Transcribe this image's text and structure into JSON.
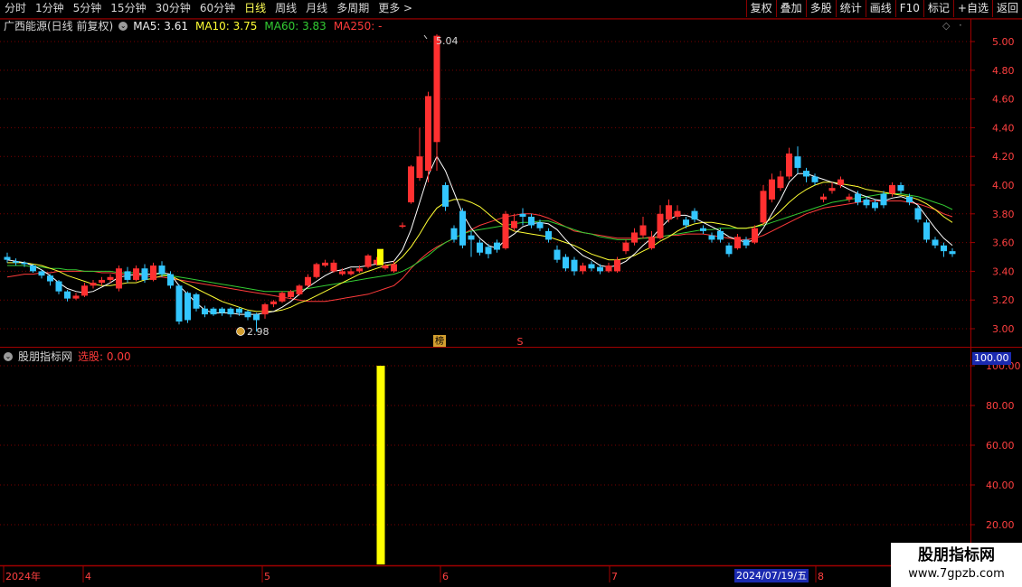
{
  "toolbar": {
    "periods": [
      "分时",
      "1分钟",
      "5分钟",
      "15分钟",
      "30分钟",
      "60分钟",
      "日线",
      "周线",
      "月线",
      "多周期",
      "更多 >"
    ],
    "active_period": "日线",
    "tools": [
      "复权",
      "叠加",
      "多股",
      "统计",
      "画线",
      "F10",
      "标记",
      "+自选",
      "返回"
    ]
  },
  "main_header": {
    "stock": "广西能源(日线 前复权)",
    "ma5": "MA5: 3.61",
    "ma10": "MA10: 3.75",
    "ma60": "MA60: 3.83",
    "ma250": "MA250: -"
  },
  "sub_header": {
    "indicator": "股朋指标网",
    "xuangu": "选股: 0.00"
  },
  "colors": {
    "up": "#ff3030",
    "down": "#33c6ff",
    "ma5": "#ffffff",
    "ma10": "#ffff33",
    "ma60": "#33cc33",
    "ma250": "#ff3b3b",
    "frame": "#a00000",
    "signal": "#ffff00"
  },
  "annotations": {
    "high_label": "5.04",
    "low_label": "2.98",
    "bang_icon_text": "榜",
    "s_icon_text": "S"
  },
  "axis": {
    "price_ticks": [
      "5.00",
      "4.80",
      "4.60",
      "4.40",
      "4.20",
      "4.00",
      "3.80",
      "3.60",
      "3.40",
      "3.20",
      "3.00"
    ],
    "indicator_ticks": [
      "100.00",
      "80.00",
      "60.00",
      "40.00",
      "20.00"
    ],
    "indicator_current": "100.00",
    "date_labels": [
      "2024年",
      "4",
      "5",
      "6",
      "7",
      "8"
    ],
    "crosshair_date": "2024/07/19/五"
  },
  "watermark": {
    "title": "股朋指标网",
    "url": "www.7gpzb.com"
  },
  "chart_data": {
    "type": "candlestick",
    "ylim": [
      2.9,
      5.1
    ],
    "indicator_ylim": [
      0,
      100
    ],
    "signal_index": 43,
    "signal_value": 100,
    "candles": [
      [
        3.5,
        3.48,
        3.53,
        3.46
      ],
      [
        3.47,
        3.46,
        3.49,
        3.44
      ],
      [
        3.46,
        3.45,
        3.47,
        3.43
      ],
      [
        3.44,
        3.4,
        3.45,
        3.39
      ],
      [
        3.4,
        3.37,
        3.41,
        3.35
      ],
      [
        3.37,
        3.33,
        3.38,
        3.3
      ],
      [
        3.33,
        3.26,
        3.34,
        3.24
      ],
      [
        3.26,
        3.21,
        3.27,
        3.19
      ],
      [
        3.21,
        3.23,
        3.25,
        3.2
      ],
      [
        3.23,
        3.3,
        3.32,
        3.22
      ],
      [
        3.3,
        3.32,
        3.34,
        3.28
      ],
      [
        3.32,
        3.34,
        3.36,
        3.3
      ],
      [
        3.34,
        3.36,
        3.38,
        3.32
      ],
      [
        3.28,
        3.42,
        3.44,
        3.26
      ],
      [
        3.4,
        3.34,
        3.43,
        3.32
      ],
      [
        3.34,
        3.42,
        3.44,
        3.33
      ],
      [
        3.42,
        3.34,
        3.45,
        3.32
      ],
      [
        3.34,
        3.44,
        3.46,
        3.33
      ],
      [
        3.44,
        3.38,
        3.47,
        3.36
      ],
      [
        3.38,
        3.3,
        3.4,
        3.28
      ],
      [
        3.3,
        3.05,
        3.31,
        3.03
      ],
      [
        3.25,
        3.06,
        3.26,
        3.04
      ],
      [
        3.24,
        3.14,
        3.25,
        3.12
      ],
      [
        3.14,
        3.1,
        3.16,
        3.08
      ],
      [
        3.14,
        3.1,
        3.15,
        3.09
      ],
      [
        3.14,
        3.11,
        3.15,
        3.09
      ],
      [
        3.14,
        3.1,
        3.15,
        3.08
      ],
      [
        3.14,
        3.11,
        3.15,
        3.09
      ],
      [
        3.12,
        3.08,
        3.13,
        3.06
      ],
      [
        3.1,
        3.06,
        3.11,
        2.98
      ],
      [
        3.1,
        3.17,
        3.18,
        3.07
      ],
      [
        3.17,
        3.19,
        3.2,
        3.15
      ],
      [
        3.19,
        3.25,
        3.26,
        3.18
      ],
      [
        3.22,
        3.26,
        3.27,
        3.21
      ],
      [
        3.24,
        3.3,
        3.31,
        3.23
      ],
      [
        3.3,
        3.36,
        3.38,
        3.29
      ],
      [
        3.36,
        3.45,
        3.46,
        3.35
      ],
      [
        3.44,
        3.46,
        3.48,
        3.43
      ],
      [
        3.4,
        3.46,
        3.48,
        3.39
      ],
      [
        3.38,
        3.4,
        3.42,
        3.37
      ],
      [
        3.38,
        3.4,
        3.42,
        3.37
      ],
      [
        3.4,
        3.42,
        3.44,
        3.39
      ],
      [
        3.43,
        3.51,
        3.52,
        3.42
      ],
      [
        3.45,
        3.48,
        3.5,
        3.44
      ],
      [
        3.42,
        3.44,
        3.45,
        3.41
      ],
      [
        3.4,
        3.45,
        3.47,
        3.39
      ],
      [
        3.71,
        3.72,
        3.74,
        3.7
      ],
      [
        3.88,
        4.13,
        4.14,
        3.87
      ],
      [
        4.05,
        4.2,
        4.4,
        4.03
      ],
      [
        4.1,
        4.62,
        4.65,
        4.02
      ],
      [
        4.3,
        5.04,
        5.05,
        4.1
      ],
      [
        4.0,
        3.85,
        4.02,
        3.82
      ],
      [
        3.7,
        3.62,
        3.72,
        3.6
      ],
      [
        3.82,
        3.58,
        3.84,
        3.56
      ],
      [
        3.65,
        3.62,
        3.68,
        3.5
      ],
      [
        3.6,
        3.53,
        3.62,
        3.51
      ],
      [
        3.57,
        3.52,
        3.59,
        3.49
      ],
      [
        3.6,
        3.55,
        3.62,
        3.53
      ],
      [
        3.56,
        3.8,
        3.82,
        3.55
      ],
      [
        3.7,
        3.75,
        3.8,
        3.68
      ],
      [
        3.8,
        3.78,
        3.84,
        3.72
      ],
      [
        3.78,
        3.72,
        3.8,
        3.7
      ],
      [
        3.74,
        3.7,
        3.76,
        3.68
      ],
      [
        3.68,
        3.62,
        3.7,
        3.6
      ],
      [
        3.55,
        3.48,
        3.58,
        3.46
      ],
      [
        3.5,
        3.42,
        3.52,
        3.4
      ],
      [
        3.48,
        3.4,
        3.5,
        3.37
      ],
      [
        3.4,
        3.44,
        3.46,
        3.38
      ],
      [
        3.45,
        3.42,
        3.47,
        3.4
      ],
      [
        3.43,
        3.4,
        3.45,
        3.38
      ],
      [
        3.4,
        3.44,
        3.46,
        3.39
      ],
      [
        3.4,
        3.48,
        3.5,
        3.39
      ],
      [
        3.54,
        3.6,
        3.62,
        3.52
      ],
      [
        3.6,
        3.67,
        3.7,
        3.58
      ],
      [
        3.65,
        3.72,
        3.78,
        3.63
      ],
      [
        3.56,
        3.64,
        3.68,
        3.55
      ],
      [
        3.63,
        3.8,
        3.86,
        3.62
      ],
      [
        3.76,
        3.86,
        3.9,
        3.74
      ],
      [
        3.78,
        3.82,
        3.86,
        3.76
      ],
      [
        3.76,
        3.72,
        3.78,
        3.7
      ],
      [
        3.82,
        3.76,
        3.84,
        3.74
      ],
      [
        3.7,
        3.68,
        3.72,
        3.66
      ],
      [
        3.65,
        3.62,
        3.67,
        3.6
      ],
      [
        3.68,
        3.62,
        3.7,
        3.6
      ],
      [
        3.58,
        3.52,
        3.6,
        3.5
      ],
      [
        3.56,
        3.64,
        3.66,
        3.55
      ],
      [
        3.62,
        3.58,
        3.64,
        3.56
      ],
      [
        3.6,
        3.7,
        3.72,
        3.59
      ],
      [
        3.74,
        3.96,
        4.0,
        3.72
      ],
      [
        3.9,
        4.04,
        4.08,
        3.88
      ],
      [
        3.98,
        4.06,
        4.1,
        3.96
      ],
      [
        4.06,
        4.22,
        4.26,
        4.04
      ],
      [
        4.2,
        4.12,
        4.27,
        4.08
      ],
      [
        4.1,
        4.06,
        4.12,
        4.02
      ],
      [
        4.06,
        4.02,
        4.08,
        4.0
      ],
      [
        3.9,
        3.92,
        3.94,
        3.88
      ],
      [
        3.96,
        3.98,
        4.02,
        3.94
      ],
      [
        4.0,
        4.04,
        4.06,
        3.98
      ],
      [
        3.9,
        3.92,
        3.94,
        3.88
      ],
      [
        3.94,
        3.88,
        3.96,
        3.86
      ],
      [
        3.9,
        3.86,
        3.92,
        3.84
      ],
      [
        3.88,
        3.84,
        3.9,
        3.82
      ],
      [
        3.94,
        3.86,
        3.96,
        3.84
      ],
      [
        3.94,
        4.0,
        4.02,
        3.92
      ],
      [
        4.0,
        3.96,
        4.02,
        3.94
      ],
      [
        3.92,
        3.88,
        3.94,
        3.86
      ],
      [
        3.84,
        3.76,
        3.86,
        3.74
      ],
      [
        3.74,
        3.62,
        3.76,
        3.6
      ],
      [
        3.62,
        3.58,
        3.64,
        3.56
      ],
      [
        3.58,
        3.54,
        3.6,
        3.5
      ],
      [
        3.54,
        3.52,
        3.56,
        3.5
      ]
    ],
    "ma5": [
      3.48,
      3.47,
      3.46,
      3.44,
      3.41,
      3.37,
      3.32,
      3.28,
      3.26,
      3.25,
      3.26,
      3.29,
      3.32,
      3.36,
      3.37,
      3.38,
      3.38,
      3.38,
      3.39,
      3.38,
      3.3,
      3.24,
      3.18,
      3.13,
      3.11,
      3.11,
      3.11,
      3.1,
      3.1,
      3.1,
      3.11,
      3.12,
      3.15,
      3.19,
      3.24,
      3.29,
      3.33,
      3.37,
      3.4,
      3.41,
      3.43,
      3.43,
      3.44,
      3.45,
      3.46,
      3.47,
      3.55,
      3.69,
      3.88,
      4.07,
      4.2,
      4.1,
      3.95,
      3.8,
      3.7,
      3.63,
      3.58,
      3.56,
      3.62,
      3.66,
      3.71,
      3.73,
      3.74,
      3.73,
      3.69,
      3.62,
      3.56,
      3.51,
      3.48,
      3.44,
      3.43,
      3.44,
      3.47,
      3.52,
      3.58,
      3.63,
      3.7,
      3.76,
      3.79,
      3.79,
      3.77,
      3.74,
      3.71,
      3.68,
      3.64,
      3.62,
      3.6,
      3.62,
      3.7,
      3.8,
      3.9,
      4.02,
      4.08,
      4.08,
      4.06,
      4.04,
      4.02,
      4.0,
      3.97,
      3.94,
      3.92,
      3.9,
      3.89,
      3.91,
      3.92,
      3.9,
      3.86,
      3.78,
      3.7,
      3.63,
      3.58
    ],
    "ma10": [
      3.46,
      3.46,
      3.46,
      3.45,
      3.44,
      3.42,
      3.4,
      3.37,
      3.35,
      3.33,
      3.31,
      3.3,
      3.3,
      3.31,
      3.32,
      3.32,
      3.34,
      3.35,
      3.37,
      3.37,
      3.34,
      3.31,
      3.28,
      3.25,
      3.22,
      3.19,
      3.17,
      3.15,
      3.13,
      3.12,
      3.12,
      3.12,
      3.13,
      3.15,
      3.18,
      3.2,
      3.23,
      3.26,
      3.29,
      3.32,
      3.35,
      3.38,
      3.4,
      3.42,
      3.44,
      3.45,
      3.5,
      3.57,
      3.66,
      3.76,
      3.84,
      3.88,
      3.9,
      3.9,
      3.88,
      3.85,
      3.8,
      3.75,
      3.71,
      3.68,
      3.67,
      3.66,
      3.65,
      3.64,
      3.62,
      3.6,
      3.58,
      3.55,
      3.52,
      3.5,
      3.48,
      3.48,
      3.49,
      3.51,
      3.54,
      3.57,
      3.61,
      3.64,
      3.68,
      3.71,
      3.73,
      3.74,
      3.74,
      3.73,
      3.72,
      3.7,
      3.7,
      3.71,
      3.73,
      3.77,
      3.82,
      3.88,
      3.93,
      3.97,
      4.0,
      4.02,
      4.02,
      4.01,
      4.0,
      3.99,
      3.97,
      3.96,
      3.95,
      3.94,
      3.93,
      3.92,
      3.9,
      3.87,
      3.83,
      3.78,
      3.74
    ],
    "ma60": [
      3.44,
      3.44,
      3.44,
      3.43,
      3.43,
      3.42,
      3.42,
      3.41,
      3.41,
      3.4,
      3.4,
      3.4,
      3.4,
      3.39,
      3.39,
      3.39,
      3.38,
      3.38,
      3.38,
      3.37,
      3.36,
      3.35,
      3.34,
      3.33,
      3.32,
      3.31,
      3.3,
      3.29,
      3.28,
      3.27,
      3.26,
      3.26,
      3.26,
      3.26,
      3.27,
      3.28,
      3.29,
      3.3,
      3.31,
      3.32,
      3.33,
      3.34,
      3.35,
      3.36,
      3.37,
      3.38,
      3.4,
      3.43,
      3.47,
      3.51,
      3.56,
      3.6,
      3.63,
      3.66,
      3.68,
      3.69,
      3.7,
      3.71,
      3.72,
      3.73,
      3.74,
      3.74,
      3.75,
      3.75,
      3.73,
      3.71,
      3.69,
      3.67,
      3.66,
      3.64,
      3.63,
      3.62,
      3.62,
      3.62,
      3.63,
      3.63,
      3.64,
      3.65,
      3.66,
      3.67,
      3.68,
      3.69,
      3.69,
      3.7,
      3.7,
      3.7,
      3.7,
      3.71,
      3.72,
      3.74,
      3.76,
      3.78,
      3.8,
      3.82,
      3.84,
      3.86,
      3.88,
      3.89,
      3.9,
      3.91,
      3.92,
      3.93,
      3.94,
      3.94,
      3.94,
      3.93,
      3.92,
      3.9,
      3.88,
      3.86,
      3.83
    ],
    "ma250": [
      3.36,
      3.37,
      3.38,
      3.38,
      3.39,
      3.39,
      3.4,
      3.4,
      3.4,
      3.4,
      3.4,
      3.39,
      3.39,
      3.38,
      3.38,
      3.37,
      3.37,
      3.36,
      3.36,
      3.35,
      3.34,
      3.33,
      3.32,
      3.31,
      3.3,
      3.29,
      3.28,
      3.27,
      3.26,
      3.25,
      3.24,
      3.23,
      3.22,
      3.21,
      3.2,
      3.19,
      3.19,
      3.19,
      3.2,
      3.21,
      3.22,
      3.23,
      3.24,
      3.26,
      3.28,
      3.3,
      3.35,
      3.42,
      3.48,
      3.53,
      3.57,
      3.6,
      3.63,
      3.66,
      3.69,
      3.72,
      3.74,
      3.76,
      3.78,
      3.79,
      3.8,
      3.8,
      3.79,
      3.77,
      3.74,
      3.71,
      3.68,
      3.67,
      3.66,
      3.65,
      3.64,
      3.63,
      3.63,
      3.63,
      3.63,
      3.64,
      3.64,
      3.65,
      3.65,
      3.66,
      3.66,
      3.66,
      3.65,
      3.64,
      3.63,
      3.62,
      3.62,
      3.63,
      3.65,
      3.68,
      3.71,
      3.74,
      3.77,
      3.8,
      3.82,
      3.84,
      3.85,
      3.86,
      3.87,
      3.88,
      3.89,
      3.89,
      3.89,
      3.89,
      3.89,
      3.88,
      3.87,
      3.85,
      3.83,
      3.8,
      3.78
    ]
  }
}
